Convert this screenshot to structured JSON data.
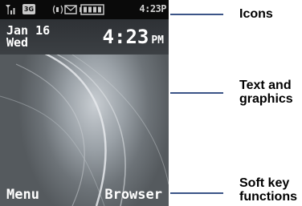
{
  "phone_screen": {
    "status_bar": {
      "time": "4:23P",
      "icons": [
        "signal-strength-icon",
        "3g-network-icon",
        "speaker-icon",
        "message-icon",
        "battery-icon"
      ],
      "network_badge": "3G"
    },
    "date": {
      "month_day": "Jan 16",
      "weekday": "Wed"
    },
    "clock": {
      "time": "4:23",
      "ampm": "PM"
    },
    "softkeys": {
      "left": "Menu",
      "right": "Browser"
    }
  },
  "callouts": [
    {
      "lines": [
        "Icons"
      ]
    },
    {
      "lines": [
        "Text and",
        "graphics"
      ]
    },
    {
      "lines": [
        "Soft key",
        "functions"
      ]
    }
  ],
  "colors": {
    "callout_line": "#3b5487",
    "status_bar_bg": "#0a0a0a"
  }
}
